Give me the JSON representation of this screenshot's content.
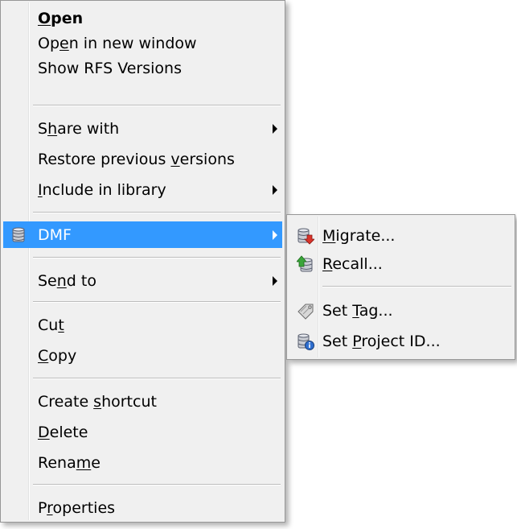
{
  "main_menu": {
    "items": [
      {
        "pre": "",
        "u": "O",
        "post": "pen",
        "bold": true
      },
      {
        "pre": "Op",
        "u": "e",
        "post": "n in new window"
      },
      {
        "pre": "Show RFS Versions",
        "u": "",
        "post": ""
      },
      {
        "pre": "S",
        "u": "h",
        "post": "are with"
      },
      {
        "pre": "Restore previous ",
        "u": "v",
        "post": "ersions"
      },
      {
        "pre": "",
        "u": "I",
        "post": "nclude in library"
      },
      {
        "pre": "DMF",
        "u": "",
        "post": ""
      },
      {
        "pre": "Se",
        "u": "n",
        "post": "d to"
      },
      {
        "pre": "Cu",
        "u": "t",
        "post": ""
      },
      {
        "pre": "",
        "u": "C",
        "post": "opy"
      },
      {
        "pre": "Create ",
        "u": "s",
        "post": "hortcut"
      },
      {
        "pre": "",
        "u": "D",
        "post": "elete"
      },
      {
        "pre": "Rena",
        "u": "m",
        "post": "e"
      },
      {
        "pre": "P",
        "u": "r",
        "post": "operties"
      }
    ]
  },
  "sub_menu": {
    "items": [
      {
        "pre": "",
        "u": "M",
        "post": "igrate...",
        "icon": "migrate-icon"
      },
      {
        "pre": "",
        "u": "R",
        "post": "ecall...",
        "icon": "recall-icon"
      },
      {
        "pre": "Set ",
        "u": "T",
        "post": "ag...",
        "icon": "tag-icon"
      },
      {
        "pre": "Set ",
        "u": "P",
        "post": "roject ID...",
        "icon": "project-id-icon"
      }
    ]
  },
  "colors": {
    "menu_bg": "#f0f0f0",
    "highlight": "#3399ff",
    "border": "#979797"
  }
}
